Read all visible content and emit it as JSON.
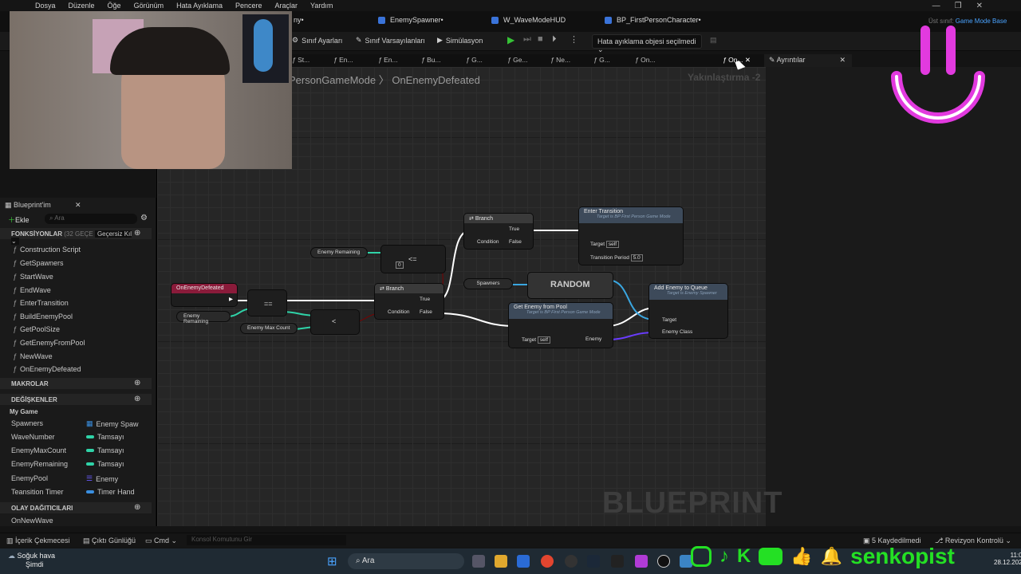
{
  "menu": [
    "Dosya",
    "Düzenle",
    "Öğe",
    "Görünüm",
    "Hata Ayıklama",
    "Pencere",
    "Araçlar",
    "Yardım"
  ],
  "doc_tabs": [
    {
      "label": "ny•",
      "color": "#3a73d9"
    },
    {
      "label": "EnemySpawner•",
      "color": "#3a73d9"
    },
    {
      "label": "W_WaveModeHUD",
      "color": "#3a73d9"
    },
    {
      "label": "BP_FirstPersonCharacter•",
      "color": "#3a73d9"
    }
  ],
  "top_right": {
    "prefix": "Üst sınıf:",
    "value": "Game Mode Base"
  },
  "toolbar": {
    "class_settings": "Sınıf Ayarları",
    "class_defaults": "Sınıf Varsayılanları",
    "simulation": "Simülasyon",
    "debug_dropdown": "Hata ayıklama objesi seçilmedi"
  },
  "func_tabs": [
    "St...",
    "En...",
    "En...",
    "Bu...",
    "G...",
    "Ge...",
    "Ne...",
    "G...",
    "On...",
    "On..."
  ],
  "details_tab": "Ayrıntılar",
  "breadcrumb": "PersonGameMode  〉 OnEnemyDefeated",
  "zoom": "Yakınlaştırma -2",
  "watermark": "BLUEPRINT",
  "left_panel": {
    "title": "Blueprint'im",
    "add_label": "Ekle",
    "search_placeholder": "Ara",
    "functions_header": "FONKSİYONLAR",
    "functions_note": "(32 GEÇE",
    "functions_filter": "Geçersiz Kıl",
    "functions": [
      "Construction Script",
      "GetSpawners",
      "StartWave",
      "EndWave",
      "EnterTransition",
      "BuildEnemyPool",
      "GetPoolSize",
      "GetEnemyFromPool",
      "NewWave",
      "OnEnemyDefeated"
    ],
    "macros_header": "MAKROLAR",
    "variables_header": "DEĞİŞKENLER",
    "var_category": "My Game",
    "variables": [
      {
        "name": "Spawners",
        "type": "Enemy Spaw",
        "color": "#3a8fe0"
      },
      {
        "name": "WaveNumber",
        "type": "Tamsayı",
        "color": "#2fd3a8"
      },
      {
        "name": "EnemyMaxCount",
        "type": "Tamsayı",
        "color": "#2fd3a8"
      },
      {
        "name": "EnemyRemaining",
        "type": "Tamsayı",
        "color": "#2fd3a8"
      },
      {
        "name": "EnemyPool",
        "type": "Enemy",
        "color": "#6a5cff"
      },
      {
        "name": "Teansition Timer",
        "type": "Timer Hand",
        "color": "#3a8fe0"
      }
    ],
    "dispatchers_header": "OLAY DAĞITICILARI",
    "dispatchers": [
      "OnNewWave"
    ]
  },
  "nodes": {
    "event": "OnEnemyDefeated",
    "enemy_remaining_1": "Enemy Remaining",
    "enemy_remaining_2": "Enemy Remaining",
    "enemy_max_count": "Enemy Max Count",
    "eq": "==",
    "lte": "<=",
    "lt": "<",
    "zero": "0",
    "branch_top": "Branch",
    "branch_mid": "Branch",
    "condition": "Condition",
    "true": "True",
    "false": "False",
    "enter_transition": "Enter Transition",
    "enter_transition_sub": "Target is BP First Person Game Mode",
    "target": "Target",
    "self": "self",
    "transition_period": "Transition Period",
    "transition_value": "5.0",
    "spawners": "Spawners",
    "random": "RANDOM",
    "get_enemy": "Get Enemy from Pool",
    "get_enemy_sub": "Target is BP First Person Game Mode",
    "enemy_out": "Enemy",
    "add_enemy": "Add Enemy to Queue",
    "add_enemy_sub": "Target is Enemy Spawner",
    "enemy_class": "Enemy Class"
  },
  "statusbar": {
    "content_drawer": "İçerik Çekmecesi",
    "output_log": "Çıktı Günlüğü",
    "cmd": "Cmd",
    "console_placeholder": "Konsol Komutunu Gir",
    "saved": "5 Kaydedilmedi",
    "revision": "Revizyon Kontrolü"
  },
  "taskbar": {
    "weather_title": "Soğuk hava",
    "weather_sub": "Şimdi",
    "search": "Ara",
    "time": "11:07",
    "date": "28.12.2025"
  },
  "overlay": {
    "brand": "senkopist"
  }
}
